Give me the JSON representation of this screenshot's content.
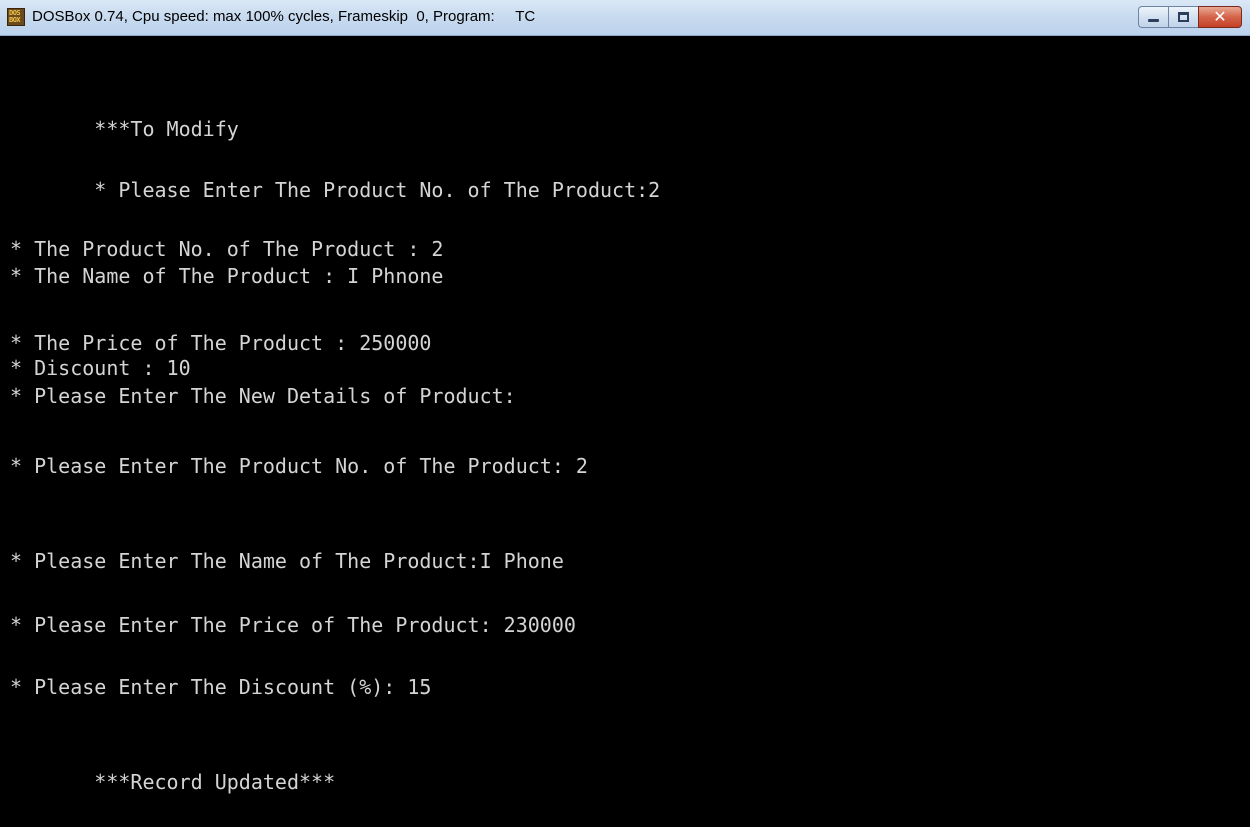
{
  "window": {
    "app_icon_text": [
      "DOS",
      "BOX"
    ],
    "title": "DOSBox 0.74, Cpu speed: max 100% cycles, Frameskip  0, Program:     TC",
    "controls": {
      "minimize": "minimize",
      "maximize": "maximize",
      "close_glyph": "✕"
    }
  },
  "console": {
    "colors": {
      "background": "#000000",
      "text": "#d4d4d4"
    },
    "lines": [
      "       ***To Modify",
      "       * Please Enter The Product No. of The Product:2",
      "* The Product No. of The Product : 2",
      "* The Name of The Product : I Phnone",
      "* The Price of The Product : 250000",
      "* Discount : 10",
      "* Please Enter The New Details of Product:",
      "* Please Enter The Product No. of The Product: 2",
      "* Please Enter The Name of The Product:I Phone",
      "* Please Enter The Price of The Product: 230000",
      "* Please Enter The Discount (%): 15",
      "       ***Record Updated***"
    ]
  }
}
